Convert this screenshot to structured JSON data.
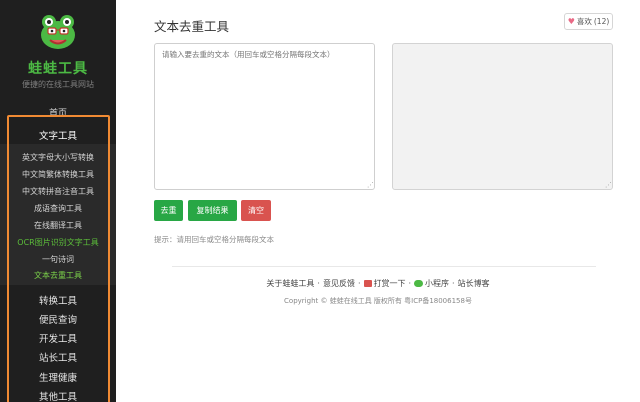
{
  "sidebar": {
    "brand": "蛙蛙工具",
    "slogan": "便捷的在线工具网站",
    "home": "首页",
    "categories": {
      "text_tools": "文字工具",
      "convert": "转换工具",
      "convenience": "便民查询",
      "dev": "开发工具",
      "webmaster": "站长工具",
      "health": "生理健康",
      "other": "其他工具"
    },
    "text_items": [
      "英文字母大小写转换",
      "中文简繁体转换工具",
      "中文转拼音注音工具",
      "成语查询工具",
      "在线翻译工具",
      "OCR图片识别文字工具",
      "一句诗词",
      "文本去重工具"
    ]
  },
  "main": {
    "title": "文本去重工具",
    "like_label": "喜欢",
    "like_count": "(12)",
    "input_placeholder": "请输入要去重的文本（用回车或空格分隔每段文本）",
    "output_value": "",
    "buttons": {
      "dedup": "去重",
      "copy": "复制结果",
      "clear": "清空"
    },
    "hint": "提示：请用回车或空格分隔每段文本"
  },
  "footer": {
    "links": [
      "关于蛙蛙工具",
      "意见反馈",
      "打赏一下",
      "小程序",
      "站长博客"
    ],
    "separator": "·",
    "copyright": "Copyright © 蛙蛙在线工具 版权所有 粤ICP备18006158号"
  },
  "colors": {
    "brand_green": "#4cb944",
    "button_green": "#28a745",
    "button_red": "#d9534f",
    "sidebar_bg": "#1f1f1f",
    "highlight_orange": "#f08a33"
  }
}
